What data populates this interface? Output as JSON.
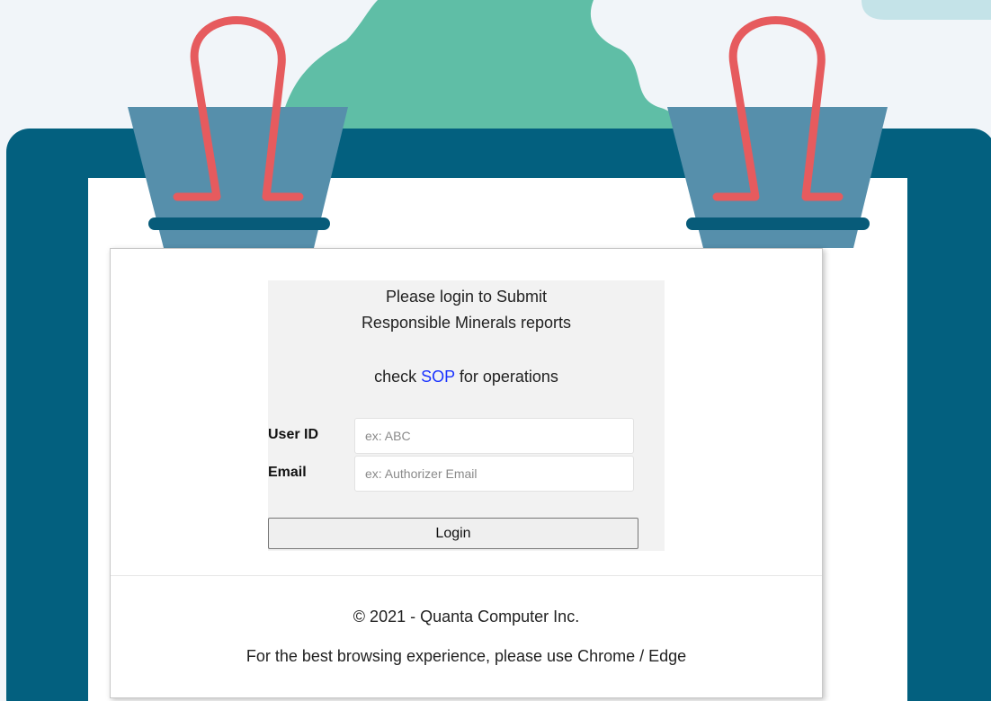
{
  "colors": {
    "background": "#f1f5f9",
    "board": "#03607f",
    "paper": "#ffffff",
    "blob": "#5fbea6",
    "cloud": "#c4e3e8",
    "clip_body": "#568fab",
    "clip_wire": "#e65b5e",
    "clip_bar": "#075b79",
    "link": "#1a33ff"
  },
  "login": {
    "intro_line_1": "Please login to Submit",
    "intro_line_2": "Responsible Minerals reports",
    "sop_prefix": "check ",
    "sop_link": "SOP",
    "sop_suffix": " for operations",
    "user_id_label": "User ID",
    "user_id_placeholder": "ex: ABC",
    "email_label": "Email",
    "email_placeholder": "ex: Authorizer Email",
    "login_button": "Login"
  },
  "footer": {
    "copyright": "© 2021 - Quanta Computer Inc.",
    "browser_note": "For the best browsing experience, please use Chrome / Edge"
  },
  "icons": {
    "left_clip": "binder-clip-icon",
    "right_clip": "binder-clip-icon"
  }
}
